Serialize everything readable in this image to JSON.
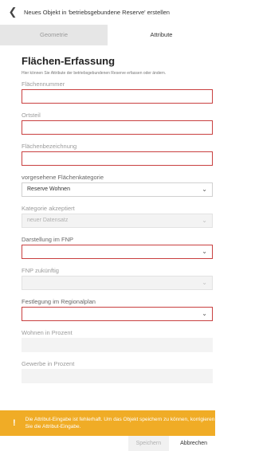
{
  "header": {
    "back_icon": "chevron-left-icon",
    "title": "Neues Objekt in 'betriebsgebundene Reserve' erstellen"
  },
  "tabs": [
    {
      "label": "Geometrie",
      "active": false
    },
    {
      "label": "Attribute",
      "active": true
    }
  ],
  "form": {
    "heading": "Flächen-Erfassung",
    "description": "Hier können Sie Attribute der betriebsgebundenen Reserve erfassen oder ändern.",
    "fields": {
      "flaechennummer": {
        "label": "Flächennummer",
        "value": ""
      },
      "ortsteil": {
        "label": "Ortsteil",
        "value": ""
      },
      "flaechenbezeichnung": {
        "label": "Flächenbezeichnung",
        "value": ""
      },
      "flaechenkategorie": {
        "label": "vorgesehene Flächenkategorie",
        "value": "Reserve Wohnen"
      },
      "kategorie_akzeptiert": {
        "label": "Kategorie akzeptiert",
        "value": "neuer Datensatz"
      },
      "darstellung_fnp": {
        "label": "Darstellung im FNP",
        "value": ""
      },
      "fnp_zukuenftig": {
        "label": "FNP zukünftig",
        "value": ""
      },
      "regionalplan": {
        "label": "Festlegung im Regionalplan",
        "value": ""
      },
      "wohnen_prozent": {
        "label": "Wohnen in Prozent",
        "value": ""
      },
      "gewerbe_prozent": {
        "label": "Gewerbe in Prozent",
        "value": ""
      }
    }
  },
  "banner": {
    "icon": "!",
    "text": "Die Attribut-Eingabe ist fehlerhaft. Um das Objekt speichern zu können, korrigieren Sie die Attribut-Eingabe.",
    "color": "#f0ac26"
  },
  "footer": {
    "save_label": "Speichern",
    "cancel_label": "Abbrechen"
  },
  "colors": {
    "error_border": "#c94040",
    "tab_inactive_bg": "#e6e6e6"
  }
}
